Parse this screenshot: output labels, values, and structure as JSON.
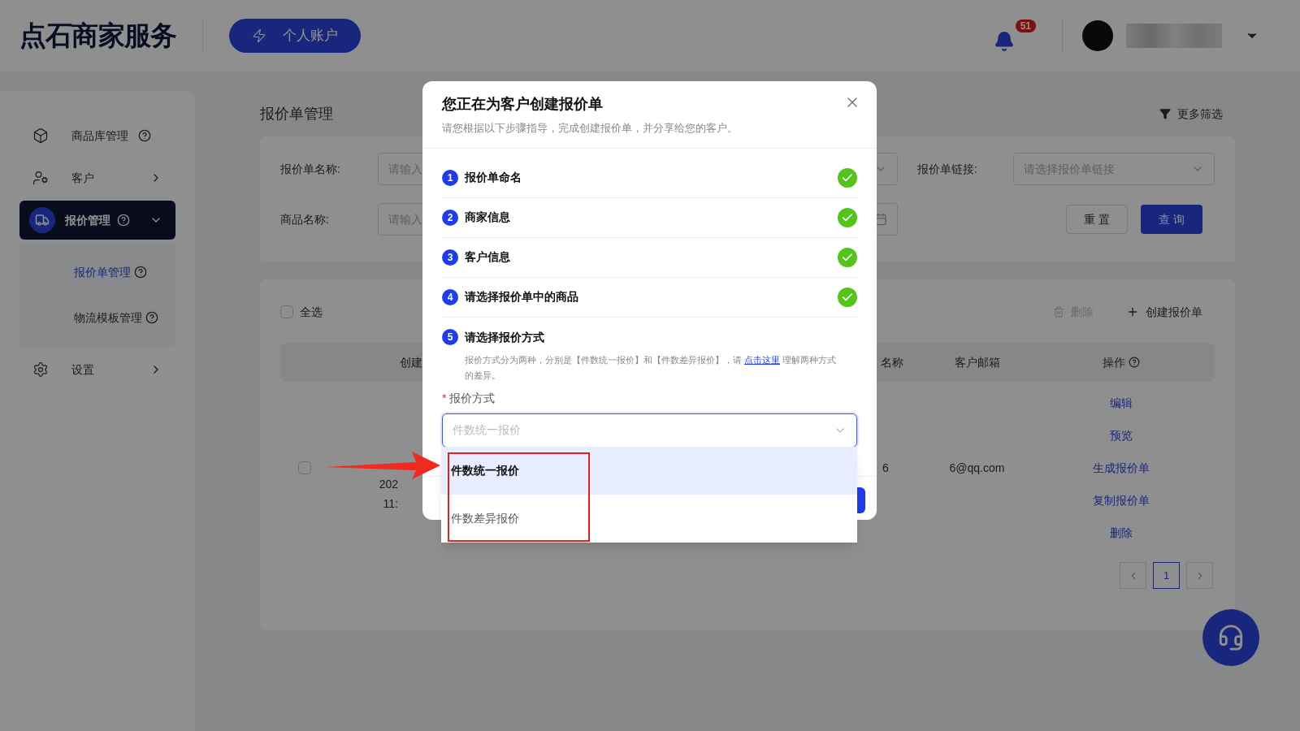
{
  "header": {
    "logo": "点石商家服务",
    "account_button": "个人账户",
    "notifications": {
      "count": "51"
    }
  },
  "sidebar": {
    "items": [
      {
        "label": "商品库管理",
        "kind": "help",
        "selected": false
      },
      {
        "label": "客户",
        "kind": "chevron",
        "selected": false
      },
      {
        "label": "报价管理",
        "kind": "group",
        "selected": true,
        "expanded": true,
        "children": [
          {
            "label": "报价单管理",
            "selected": true
          },
          {
            "label": "物流模板管理",
            "selected": false
          }
        ]
      },
      {
        "label": "设置",
        "kind": "chevron",
        "selected": false
      }
    ]
  },
  "page": {
    "title": "报价单管理",
    "more_filters": "更多筛选"
  },
  "filters": {
    "rows": [
      {
        "label": "报价单名称:",
        "placeholder": "请输入",
        "kind": "select"
      },
      {
        "label": "商品名称:",
        "placeholder": "请输入",
        "kind": "date"
      }
    ],
    "link_field": {
      "label": "报价单链接:",
      "placeholder": "请选择报价单链接"
    },
    "reset_button": "重 置",
    "query_button": "查 询"
  },
  "list": {
    "select_all": {
      "label": "全选",
      "checked": false
    },
    "delete_button": {
      "label": "删除",
      "disabled": true
    },
    "create_button": "创建报价单",
    "columns": [
      {
        "label": "创建"
      },
      {
        "label": "名称"
      },
      {
        "label": "客户邮箱"
      },
      {
        "label": "操作"
      }
    ],
    "rows": [
      {
        "selected": false,
        "created": [
          "202",
          "11:"
        ],
        "name": "6",
        "email": "6@qq.com",
        "actions": [
          "编辑",
          "预览",
          "生成报价单",
          "复制报价单",
          "删除"
        ]
      }
    ],
    "pagination": {
      "pages": [
        {
          "label": "1",
          "selected": true
        }
      ]
    }
  },
  "modal": {
    "title": "您正在为客户创建报价单",
    "subtitle": "请您根据以下步骤指导，完成创建报价单，并分享给您的客户。",
    "steps": [
      {
        "number": "1",
        "label": "报价单命名",
        "done": true
      },
      {
        "number": "2",
        "label": "商家信息",
        "done": true
      },
      {
        "number": "3",
        "label": "客户信息",
        "done": true
      },
      {
        "number": "4",
        "label": "请选择报价单中的商品",
        "done": true
      },
      {
        "number": "5",
        "label": "请选择报价方式",
        "done": false
      }
    ],
    "description": {
      "before": "报价方式分为两种，分别是【件数统一报价】和【件数差异报价】，请 ",
      "link": "点击这里",
      "after": " 理解两种方式的差异。"
    },
    "field": {
      "label": "报价方式",
      "required_mark": "*",
      "placeholder": "件数统一报价",
      "open": true
    },
    "options": [
      {
        "label": "件数统一报价",
        "selected": true
      },
      {
        "label": "件数差异报价",
        "selected": false
      }
    ]
  }
}
